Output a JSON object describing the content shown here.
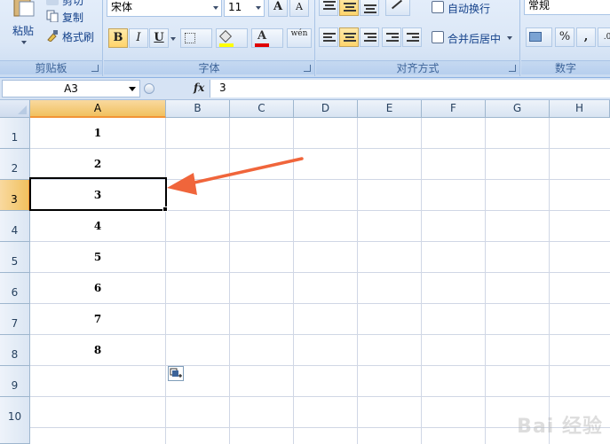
{
  "ribbon": {
    "clipboard": {
      "paste_label": "粘贴",
      "cut_label": "剪切",
      "copy_label": "复制",
      "format_painter_label": "格式刷",
      "group_label": "剪贴板"
    },
    "font": {
      "font_name": "宋体",
      "font_size": "11",
      "grow_label": "A",
      "shrink_label": "A",
      "bold_label": "B",
      "italic_label": "I",
      "underline_label": "U",
      "font_color_label": "A",
      "phonetic_label": "wén",
      "group_label": "字体"
    },
    "alignment": {
      "wrap_text_label": "自动换行",
      "merge_center_label": "合并后居中",
      "group_label": "对齐方式"
    },
    "number": {
      "format_value": "常规",
      "percent_label": "%",
      "comma_label": ",",
      "group_label": "数字"
    }
  },
  "formula_bar": {
    "name_box": "A3",
    "fx_label": "fx",
    "content": "3"
  },
  "sheet": {
    "columns": [
      "A",
      "B",
      "C",
      "D",
      "E",
      "F",
      "G",
      "H"
    ],
    "rows": [
      "1",
      "2",
      "3",
      "4",
      "5",
      "6",
      "7",
      "8",
      "9",
      "10"
    ],
    "cells_a": [
      "1",
      "2",
      "3",
      "4",
      "5",
      "6",
      "7",
      "8"
    ],
    "selected_cell": "A3"
  },
  "colors": {
    "selection_orange": "#f29436",
    "annotation_arrow": "#f0653b"
  },
  "watermark": "Bai 经验"
}
